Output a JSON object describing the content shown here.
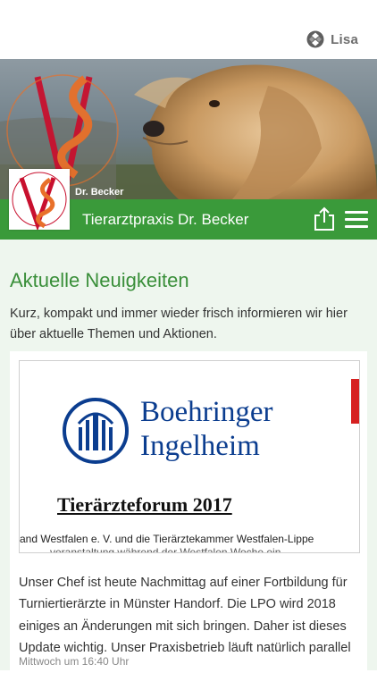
{
  "user": {
    "name": "Lisa",
    "icon": "app-badge-icon"
  },
  "header": {
    "caption": "Dr. Becker",
    "practice_name": "Tierarztpraxis Dr. Becker",
    "share_icon": "share-icon",
    "menu_icon": "hamburger-menu-icon",
    "brand_green": "#3a9a3a"
  },
  "news": {
    "title": "Aktuelle Neuigkeiten",
    "intro": "Kurz, kompakt und immer wieder frisch informieren wir hier über aktuelle Themen und Aktionen.",
    "posts": [
      {
        "image": {
          "brand_line1": "Boehringer",
          "brand_line2": "Ingelheim",
          "heading": "Tierärzteforum 2017",
          "scan_text": "and Westfalen e. V. und die Tierärztekammer Westfalen-Lippe",
          "scan_text_cut": "veranstaltung während der Westfalen Woche ein"
        },
        "text": "Unser Chef ist heute Nachmittag auf einer Fortbildung für Turniertierärzte in Münster Handorf. Die LPO wird 2018 einiges an Änderungen mit sich bringen. Daher ist dieses Update wichtig. Unser Praxisbetrieb läuft natürlich parallel",
        "time": "Mittwoch um 16:40 Uhr"
      }
    ]
  }
}
